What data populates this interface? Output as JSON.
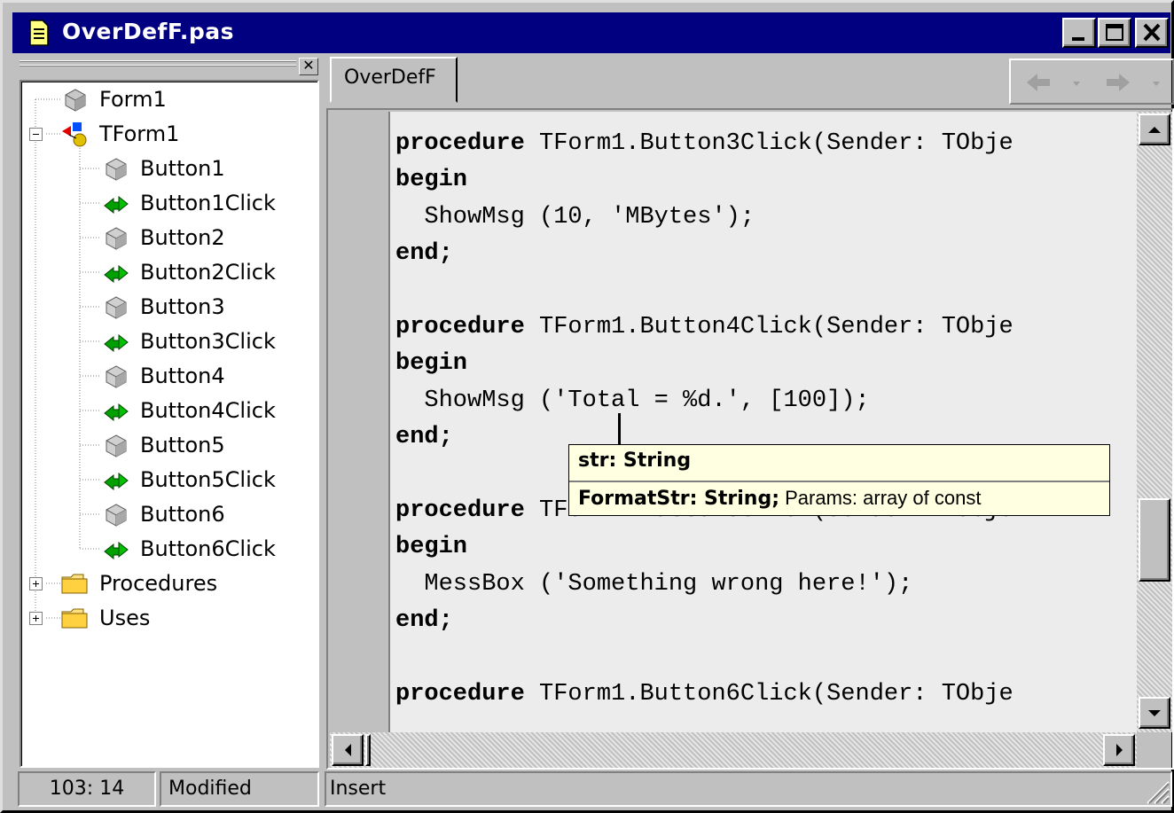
{
  "window": {
    "title": "OverDefF.pas"
  },
  "tree": {
    "root_form": "Form1",
    "class_node": "TForm1",
    "members": [
      {
        "label": "Button1",
        "icon": "component-icon"
      },
      {
        "label": "Button1Click",
        "icon": "method-icon"
      },
      {
        "label": "Button2",
        "icon": "component-icon"
      },
      {
        "label": "Button2Click",
        "icon": "method-icon"
      },
      {
        "label": "Button3",
        "icon": "component-icon"
      },
      {
        "label": "Button3Click",
        "icon": "method-icon"
      },
      {
        "label": "Button4",
        "icon": "component-icon"
      },
      {
        "label": "Button4Click",
        "icon": "method-icon"
      },
      {
        "label": "Button5",
        "icon": "component-icon"
      },
      {
        "label": "Button5Click",
        "icon": "method-icon"
      },
      {
        "label": "Button6",
        "icon": "component-icon"
      },
      {
        "label": "Button6Click",
        "icon": "method-icon"
      }
    ],
    "folders": [
      "Procedures",
      "Uses"
    ]
  },
  "editor": {
    "tab": "OverDefF",
    "lines": [
      {
        "kw": "",
        "text": ""
      },
      {
        "kw": "procedure",
        "text": " TForm1.Button3Click(Sender: TObje"
      },
      {
        "kw": "begin",
        "text": ""
      },
      {
        "kw": "",
        "text": "  ShowMsg (10, 'MBytes');"
      },
      {
        "kw": "end;",
        "text": ""
      },
      {
        "kw": "",
        "text": ""
      },
      {
        "kw": "procedure",
        "text": " TForm1.Button4Click(Sender: TObje"
      },
      {
        "kw": "begin",
        "text": ""
      },
      {
        "kw": "",
        "text": "  ShowMsg ('Total = %d.', [100]);"
      },
      {
        "kw": "end;",
        "text": ""
      },
      {
        "kw": "",
        "text": ""
      },
      {
        "kw": "procedure",
        "text": " TForm1.Button5Click(Sender: TObje"
      },
      {
        "kw": "begin",
        "text": ""
      },
      {
        "kw": "",
        "text": "  MessBox ('Something wrong here!');"
      },
      {
        "kw": "end;",
        "text": ""
      },
      {
        "kw": "",
        "text": ""
      },
      {
        "kw": "procedure",
        "text": " TForm1.Button6Click(Sender: TObje"
      }
    ],
    "code_hint": {
      "overload1": "str: String",
      "overload2_bold": "FormatStr: String;",
      "overload2_rest": " Params: array of const"
    }
  },
  "statusbar": {
    "position": "103: 14",
    "modified": "Modified",
    "mode": "Insert"
  },
  "colors": {
    "title_bg": "#000080",
    "hint_bg": "#ffffe1",
    "editor_bg": "#ececec"
  }
}
